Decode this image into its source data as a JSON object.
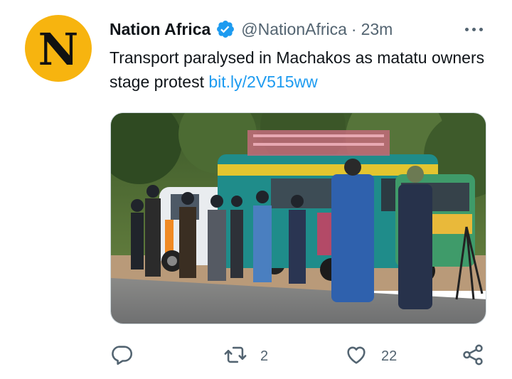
{
  "tweet": {
    "avatar_letter": "N",
    "display_name": "Nation Africa",
    "handle": "@NationAfrica",
    "separator": "·",
    "time": "23m",
    "text": "Transport paralysed in Machakos as matatu owners stage protest ",
    "link": "bit.ly/2V515ww"
  },
  "actions": {
    "reply_count": "",
    "retweet_count": "2",
    "like_count": "22"
  },
  "colors": {
    "avatar_bg": "#f7b40f",
    "verified_blue": "#1d9bf0",
    "link_blue": "#1d9bf0",
    "secondary_text": "#536471"
  },
  "icons": [
    "verified-badge-icon",
    "more-icon",
    "reply-icon",
    "retweet-icon",
    "like-icon",
    "share-icon"
  ]
}
